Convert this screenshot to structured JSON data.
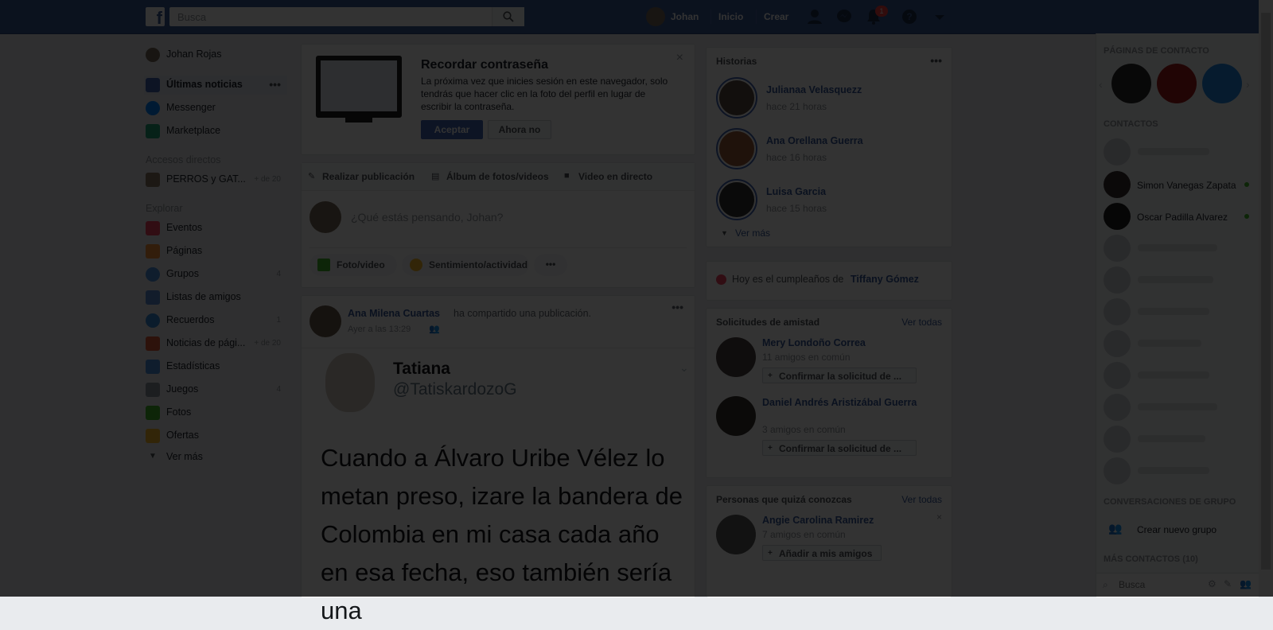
{
  "header": {
    "logo": "f",
    "search_placeholder": "Busca",
    "user_name": "Johan",
    "nav_home": "Inicio",
    "nav_create": "Crear",
    "notifications_count": "1"
  },
  "left_nav": {
    "profile_name": "Johan Rojas",
    "items": [
      {
        "label": "Últimas noticias",
        "count": ""
      },
      {
        "label": "Messenger",
        "count": ""
      },
      {
        "label": "Marketplace",
        "count": ""
      }
    ],
    "shortcuts_title": "Accesos directos",
    "shortcuts": [
      {
        "label": "PERROS y GAT...",
        "count": "+ de 20"
      }
    ],
    "explore_title": "Explorar",
    "explore": [
      {
        "label": "Eventos",
        "count": ""
      },
      {
        "label": "Páginas",
        "count": ""
      },
      {
        "label": "Grupos",
        "count": "4"
      },
      {
        "label": "Listas de amigos",
        "count": ""
      },
      {
        "label": "Recuerdos",
        "count": "1"
      },
      {
        "label": "Noticias de pági...",
        "count": "+ de 20"
      },
      {
        "label": "Estadísticas",
        "count": ""
      },
      {
        "label": "Juegos",
        "count": "4"
      },
      {
        "label": "Fotos",
        "count": ""
      },
      {
        "label": "Ofertas",
        "count": ""
      }
    ],
    "see_more": "Ver más"
  },
  "password_card": {
    "title": "Recordar contraseña",
    "body": "La próxima vez que inicies sesión en este navegador, solo tendrás que hacer clic en la foto del perfil en lugar de escribir la contraseña.",
    "accept": "Aceptar",
    "decline": "Ahora no"
  },
  "composer": {
    "tab_post": "Realizar publicación",
    "tab_album": "Álbum de fotos/videos",
    "tab_live": "Video en directo",
    "placeholder": "¿Qué estás pensando, Johan?",
    "action_photo": "Foto/video",
    "action_feeling": "Sentimiento/actividad"
  },
  "post": {
    "author": "Ana Milena Cuartas",
    "action": "ha compartido una publicación.",
    "time": "Ayer a las 13:29",
    "tweet_name": "Tatiana",
    "tweet_handle": "@TatiskardozoG",
    "tweet_text": "Cuando a Álvaro Uribe Vélez lo metan preso, izare la bandera de Colombia en mi casa cada año en esa fecha, eso también sería una"
  },
  "stories": {
    "title": "Historias",
    "items": [
      {
        "name": "Julianaa Velasquezz",
        "time": "hace 21 horas"
      },
      {
        "name": "Ana Orellana Guerra",
        "time": "hace 16 horas"
      },
      {
        "name": "Luisa Garcia",
        "time": "hace 15 horas"
      }
    ],
    "see_more": "Ver más"
  },
  "birthday": {
    "text": "Hoy es el cumpleaños de",
    "name": "Tiffany Gómez"
  },
  "friend_requests": {
    "title": "Solicitudes de amistad",
    "see_all": "Ver todas",
    "items": [
      {
        "name": "Mery Londoño Correa",
        "mutual": "11 amigos en común",
        "button": "Confirmar la solicitud de ..."
      },
      {
        "name": "Daniel Andrés Aristizábal Guerra",
        "mutual": "3 amigos en común",
        "button": "Confirmar la solicitud de ..."
      }
    ]
  },
  "pymk": {
    "title": "Personas que quizá conozcas",
    "see_all": "Ver todas",
    "items": [
      {
        "name": "Angie Carolina Ramirez",
        "mutual": "7 amigos en común",
        "button": "Añadir a mis amigos"
      }
    ]
  },
  "chat": {
    "pages_title": "PÁGINAS DE CONTACTO",
    "contacts_title": "CONTACTOS",
    "contacts": [
      {
        "name": "Simon Vanegas Zapata"
      },
      {
        "name": "Oscar Padilla Alvarez"
      }
    ],
    "group_title": "CONVERSACIONES DE GRUPO",
    "create_group": "Crear nuevo grupo",
    "more_contacts": "MÁS CONTACTOS (10)",
    "search_placeholder": "Busca"
  },
  "colors": {
    "brand": "#3b5998",
    "button": "#4267b2",
    "overlay": "rgba(0,0,0,0.8)"
  }
}
